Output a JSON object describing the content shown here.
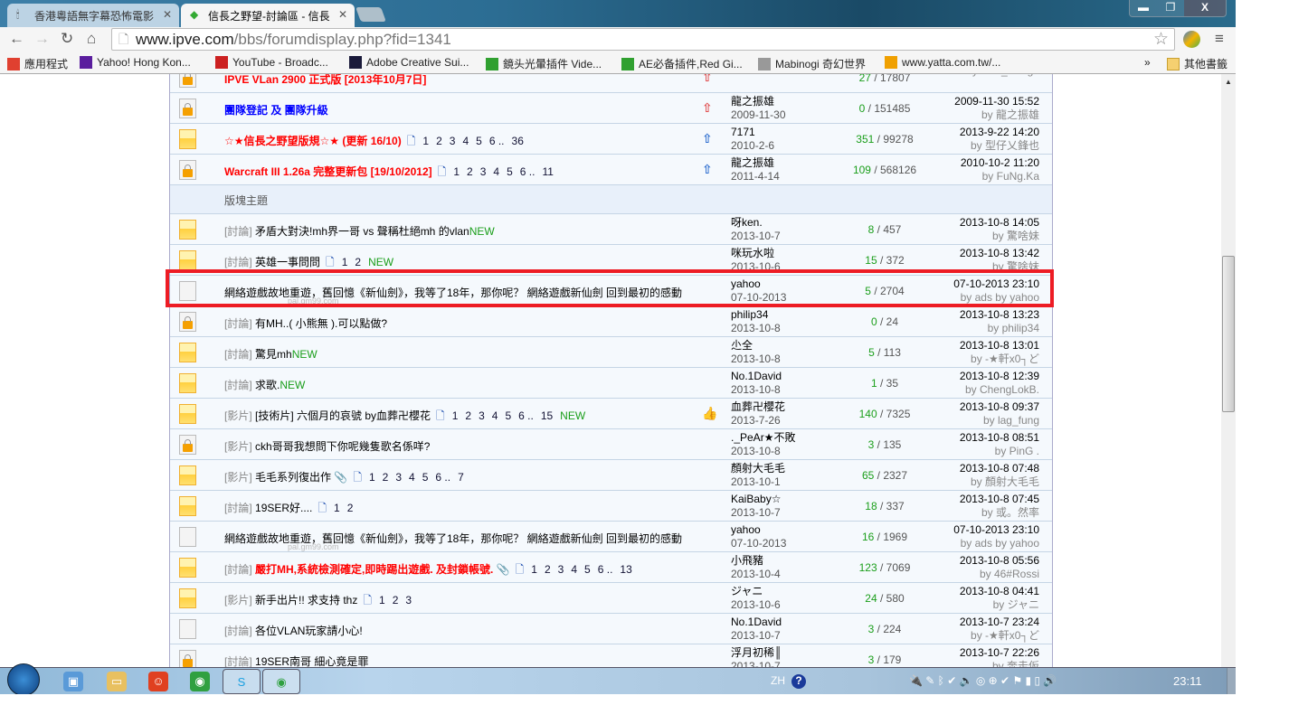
{
  "browser": {
    "tabs": [
      {
        "label": "香港粵語無字幕恐怖電影",
        "active": false
      },
      {
        "label": "信長之野望-討論區 - 信長",
        "active": true
      }
    ],
    "url_host": "www.ipve.com",
    "url_path": "/bbs/forumdisplay.php?fid=1341",
    "window_controls": {
      "minimize": "▬",
      "restore": "❐",
      "close": "X"
    },
    "bookmarks": [
      {
        "label": "應用程式",
        "icon": "apps-grid-icon",
        "color": "#e04030"
      },
      {
        "label": "Yahoo! Hong Kon...",
        "icon": "yahoo-icon",
        "color": "#5a1e9e"
      },
      {
        "label": "YouTube - Broadc...",
        "icon": "youtube-icon",
        "color": "#cc2020"
      },
      {
        "label": "Adobe Creative Sui...",
        "icon": "adobe-icon",
        "color": "#1a1a3a"
      },
      {
        "label": "鏡头光暈插件 Vide...",
        "icon": "green-square-icon",
        "color": "#30a030"
      },
      {
        "label": "AE必备插件,Red Gi...",
        "icon": "green-square-icon",
        "color": "#30a030"
      },
      {
        "label": "Mabinogi 奇幻世界",
        "icon": "mabinogi-icon",
        "color": "#999999"
      },
      {
        "label": "www.yatta.com.tw/...",
        "icon": "yatta-icon",
        "color": "#f0a000"
      }
    ],
    "bookmarks_more": "»",
    "other_bookmarks": "其他書籤"
  },
  "forum": {
    "section_label": "版塊主題",
    "rows": [
      {
        "icon": "lock",
        "title": "IPVE VLan 2900 正式版 [2013年10月7日]",
        "style": "red",
        "ricon": "hot",
        "author": "",
        "date": "2010-6-1",
        "replies": "27",
        "views": "17807",
        "last_time": "",
        "last_by": "by alan_wong8"
      },
      {
        "icon": "lock",
        "title": "團隊登記 及 團隊升級",
        "style": "blue",
        "ricon": "hot",
        "author": "龍之振雄",
        "date": "2009-11-30",
        "replies": "0",
        "views": "151485",
        "last_time": "2009-11-30 15:52",
        "last_by": "by 龍之振雄"
      },
      {
        "icon": "new",
        "title": "☆★信長之野望版規☆★ (更新 16/10)",
        "style": "red",
        "pages": [
          "1",
          "2",
          "3",
          "4",
          "5",
          "6 ..",
          "36"
        ],
        "ricon": "top",
        "author": "7171",
        "date": "2010-2-6",
        "replies": "351",
        "views": "99278",
        "last_time": "2013-9-22 14:20",
        "last_by": "by 型仔乂鋒也"
      },
      {
        "icon": "lock",
        "title": "Warcraft III 1.26a 完整更新包 [19/10/2012]",
        "style": "red",
        "pages": [
          "1",
          "2",
          "3",
          "4",
          "5",
          "6 ..",
          "11"
        ],
        "ricon": "top",
        "author": "龍之振雄",
        "date": "2011-4-14",
        "replies": "109",
        "views": "568126",
        "last_time": "2010-10-2 11:20",
        "last_by": "by FuNg.Ka"
      },
      {
        "section": true
      },
      {
        "icon": "new",
        "prefix": "[討論]",
        "title": "矛盾大對決!mh界一哥 vs 聲稱杜絕mh 的vlan",
        "new": "NEW",
        "author": "呀ken.",
        "date": "2013-10-7",
        "replies": "8",
        "views": "457",
        "last_time": "2013-10-8 14:05",
        "last_by": "by 驚啥妹"
      },
      {
        "icon": "new",
        "prefix": "[討論]",
        "title": "英雄一事問問",
        "pages": [
          "1",
          "2"
        ],
        "new": "NEW",
        "author": "咪玩水啦",
        "date": "2013-10-6",
        "replies": "15",
        "views": "372",
        "last_time": "2013-10-8 13:42",
        "last_by": "by 驚啥妹"
      },
      {
        "icon": "plain",
        "title": "網絡遊戲故地重遊，舊回憶《新仙劍》，我等了18年，那你呢？ 網絡遊戲新仙劍 回到最初的感動",
        "sub": "pal.gm99.com",
        "author": "yahoo",
        "date": "07-10-2013",
        "replies": "5",
        "views": "2704",
        "last_time": "07-10-2013 23:10",
        "last_by": "by ads by yahoo"
      },
      {
        "icon": "lock",
        "prefix": "[討論]",
        "title": "有MH..( 小熊無 ).可以點做?",
        "author": "philip34",
        "date": "2013-10-8",
        "replies": "0",
        "views": "24",
        "last_time": "2013-10-8 13:23",
        "last_by": "by philip34"
      },
      {
        "icon": "new",
        "prefix": "[討論]",
        "title": "驚見mh",
        "new": "NEW",
        "author": "尐全",
        "date": "2013-10-8",
        "replies": "5",
        "views": "113",
        "last_time": "2013-10-8 13:01",
        "last_by": "by -★軒x0┐ど"
      },
      {
        "icon": "new",
        "prefix": "[討論]",
        "title": "求歌.",
        "new": "NEW",
        "author": "No.1David",
        "date": "2013-10-8",
        "replies": "1",
        "views": "35",
        "last_time": "2013-10-8 12:39",
        "last_by": "by ChengLokB."
      },
      {
        "icon": "new",
        "prefix": "[影片]",
        "title": "[技術片] 六個月的哀號 by血葬卍櫻花",
        "pages": [
          "1",
          "2",
          "3",
          "4",
          "5",
          "6 ..",
          "15"
        ],
        "new": "NEW",
        "ricon": "thumb",
        "author": "血葬卍櫻花",
        "date": "2013-7-26",
        "replies": "140",
        "views": "7325",
        "last_time": "2013-10-8 09:37",
        "last_by": "by lag_fung"
      },
      {
        "icon": "lock",
        "prefix": "[影片]",
        "title": "ckh哥哥我想問下你呢幾隻歌名係咩?",
        "author": "._PeAr★不敗",
        "date": "2013-10-8",
        "replies": "3",
        "views": "135",
        "last_time": "2013-10-8 08:51",
        "last_by": "by PinG ."
      },
      {
        "icon": "new",
        "prefix": "[影片]",
        "title": "毛毛系列復出作",
        "clip": true,
        "pages": [
          "1",
          "2",
          "3",
          "4",
          "5",
          "6 ..",
          "7"
        ],
        "author": "顏射大毛毛",
        "date": "2013-10-1",
        "replies": "65",
        "views": "2327",
        "last_time": "2013-10-8 07:48",
        "last_by": "by 顏射大毛毛"
      },
      {
        "icon": "new",
        "prefix": "[討論]",
        "title": "19SER好....",
        "pages": [
          "1",
          "2"
        ],
        "author": "KaiBaby☆",
        "date": "2013-10-7",
        "replies": "18",
        "views": "337",
        "last_time": "2013-10-8 07:45",
        "last_by": "by 或。然率"
      },
      {
        "icon": "plain",
        "title": "網絡遊戲故地重遊，舊回憶《新仙劍》，我等了18年，那你呢？ 網絡遊戲新仙劍 回到最初的感動",
        "sub": "pal.gm99.com",
        "author": "yahoo",
        "date": "07-10-2013",
        "replies": "16",
        "views": "1969",
        "last_time": "07-10-2013 23:10",
        "last_by": "by ads by yahoo"
      },
      {
        "icon": "new",
        "prefix": "[討論]",
        "title": "嚴打MH,系統檢測確定,即時踢出遊戲. 及封鎖帳號.",
        "style": "red",
        "clip": true,
        "pages": [
          "1",
          "2",
          "3",
          "4",
          "5",
          "6 ..",
          "13"
        ],
        "author": "小飛豬",
        "date": "2013-10-4",
        "replies": "123",
        "views": "7069",
        "last_time": "2013-10-8 05:56",
        "last_by": "by 46#Rossi"
      },
      {
        "icon": "new",
        "prefix": "[影片]",
        "title": "新手出片!! 求支持 thz",
        "pages": [
          "1",
          "2",
          "3"
        ],
        "author": "ジャニ",
        "date": "2013-10-6",
        "replies": "24",
        "views": "580",
        "last_time": "2013-10-8 04:41",
        "last_by": "by ジャニ"
      },
      {
        "icon": "plain",
        "prefix": "[討論]",
        "title": "各位VLAN玩家請小心!",
        "author": "No.1David",
        "date": "2013-10-7",
        "replies": "3",
        "views": "224",
        "last_time": "2013-10-7 23:24",
        "last_by": "by -★軒x0┐ど"
      },
      {
        "icon": "lock",
        "prefix": "[討論]",
        "title": "19SER南哥 細心竟是罪",
        "author": "浮月初稀║",
        "date": "2013-10-7",
        "replies": "3",
        "views": "179",
        "last_time": "2013-10-7 22:26",
        "last_by": "by 奔走仮"
      }
    ]
  },
  "taskbar": {
    "apps": [
      "network-icon",
      "explorer-folder-icon",
      "game-icon",
      "chrome-icon",
      "skype-icon",
      "chrome-icon"
    ],
    "lang": "ZH",
    "clock": "23:11"
  },
  "colors": {
    "highlight": "#ed1c24",
    "new": "#1a9e1a",
    "sticky": "#ff0000"
  }
}
